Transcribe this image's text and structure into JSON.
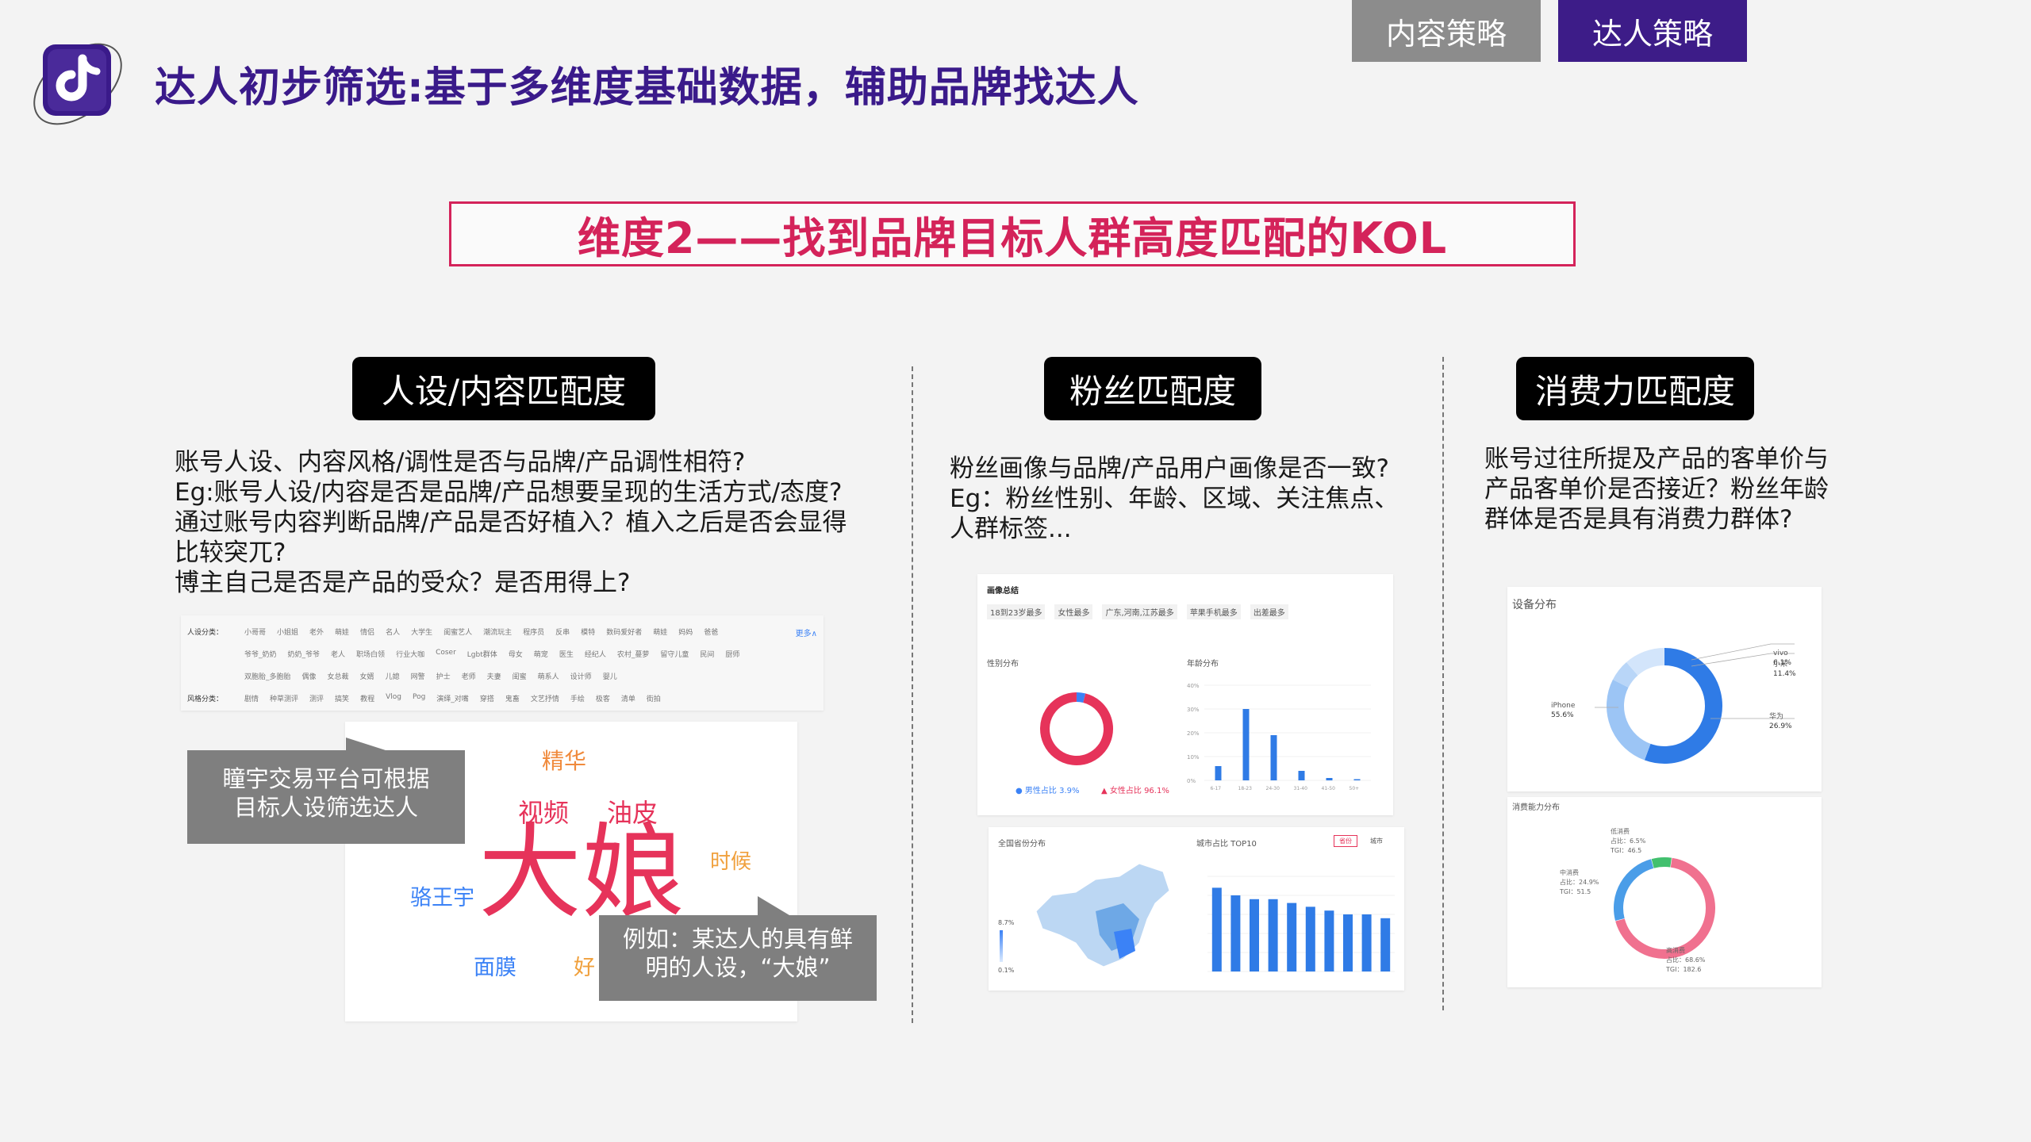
{
  "header": {
    "title": "达人初步筛选:基于多维度基础数据，辅助品牌找达人",
    "tabs": [
      {
        "label": "内容策略",
        "active": false
      },
      {
        "label": "达人策略",
        "active": true
      }
    ],
    "subtitle": "维度2——找到品牌目标人群高度匹配的KOL"
  },
  "sections": [
    {
      "heading": "人设/内容匹配度",
      "lines": [
        "账号人设、内容风格/调性是否与品牌/产品调性相符?",
        "Eg:账号人设/内容是否是品牌/产品想要呈现的生活方式/态度?",
        "通过账号内容判断品牌/产品是否好植入？植入之后是否会显得",
        "比较突兀?",
        "博主自己是否是产品的受众？是否用得上?"
      ]
    },
    {
      "heading": "粉丝匹配度",
      "lines": [
        "粉丝画像与品牌/产品用户画像是否一致?",
        "Eg：粉丝性别、年龄、区域、关注焦点、",
        "人群标签..."
      ]
    },
    {
      "heading": "消费力匹配度",
      "lines": [
        "账号过往所提及产品的客单价与",
        "产品客单价是否接近？粉丝年龄",
        "群体是否是具有消费力群体?"
      ]
    }
  ],
  "persona_panel": {
    "filter_labels": [
      "人设分类：",
      "风格分类："
    ],
    "more": "更多∧",
    "row1": [
      "小哥哥",
      "小姐姐",
      "老外",
      "萌娃",
      "情侣",
      "名人",
      "大学生",
      "闺蜜艺人",
      "潮流玩主",
      "程序员",
      "反串",
      "模特",
      "数码爱好者",
      "萌娃",
      "妈妈",
      "爸爸"
    ],
    "row2": [
      "爷爷_奶奶",
      "奶奶_爷爷",
      "老人",
      "职场白领",
      "行业大咖",
      "Coser",
      "Lgbt群体",
      "母女",
      "萌宠",
      "医生",
      "经纪人",
      "农村_蔓萝",
      "留守儿童",
      "民间",
      "厨师"
    ],
    "row3": [
      "双胞胎_多胞胎",
      "偶像",
      "女总裁",
      "女婿",
      "儿媳",
      "网警",
      "护士",
      "老师",
      "夫妻",
      "闺蜜",
      "萌系人",
      "设计师",
      "婴儿"
    ],
    "row4": [
      "剧情",
      "种草测评",
      "测评",
      "搞笑",
      "教程",
      "Vlog",
      "Pog",
      "演绎_对嘴",
      "穿搭",
      "鬼畜",
      "文艺抒情",
      "手绘",
      "极客",
      "清单",
      "街拍"
    ],
    "wordcloud": [
      "精华",
      "视频",
      "油皮",
      "大娘",
      "时候",
      "骆王宇",
      "面膜",
      "好"
    ],
    "note1": [
      "瞳宇交易平台可根据",
      "目标人设筛选达人"
    ],
    "note2": [
      "例如：某达人的具有鲜",
      "明的人设，“大娘”"
    ]
  },
  "fans_panel": {
    "title": "画像总结",
    "tags": [
      "18到23岁最多",
      "女性最多",
      "广东,河南,江苏最多",
      "苹果手机最多",
      "出差最多"
    ],
    "gender_title": "性别分布",
    "gender": [
      {
        "label": "男性占比",
        "value": "3.9%",
        "pct": 3.9,
        "color": "#3b82f6"
      },
      {
        "label": "女性占比",
        "value": "96.1%",
        "pct": 96.1,
        "color": "#e6335a"
      }
    ],
    "age_title": "年龄分布",
    "age_yticks": [
      "40%",
      "30%",
      "20%",
      "10%",
      "0%"
    ],
    "age_cats": [
      "6-17",
      "18-23",
      "24-30",
      "31-40",
      "41-50",
      "50+"
    ],
    "age_values": [
      6,
      30,
      19,
      4,
      1,
      0.5
    ],
    "map_title": "全国省份分布",
    "map_legend": [
      "8.7%",
      "0.1%"
    ],
    "city_title": "城市占比 TOP10",
    "city_tabs": [
      "省份",
      "城市"
    ],
    "city_values": [
      22,
      20,
      19,
      19,
      18,
      17,
      16,
      15,
      15,
      14
    ]
  },
  "consume_panel": {
    "device_title": "设备分布",
    "devices": [
      {
        "label": "iPhone",
        "value": "55.6%",
        "pct": 55.6,
        "color": "#2f7be6"
      },
      {
        "label": "华为",
        "value": "26.9%",
        "pct": 26.9,
        "color": "#9cc5f5"
      },
      {
        "label": "vivo",
        "value": "6.1%",
        "pct": 6.1,
        "color": "#b9d6f8"
      },
      {
        "label": "小米",
        "value": "11.4%",
        "pct": 11.4,
        "color": "#d3e5fb"
      }
    ],
    "power_title": "消费能力分布",
    "power": [
      {
        "label": "高消费",
        "share": "占比：68.6%",
        "tgi": "TGI：182.6",
        "pct": 68.6,
        "color": "#f0718f"
      },
      {
        "label": "中消费",
        "share": "占比：24.9%",
        "tgi": "TGI：51.5",
        "pct": 24.9,
        "color": "#4a9de8"
      },
      {
        "label": "低消费",
        "share": "占比：6.5%",
        "tgi": "TGI：46.5",
        "pct": 6.5,
        "color": "#42c06e"
      }
    ]
  }
}
